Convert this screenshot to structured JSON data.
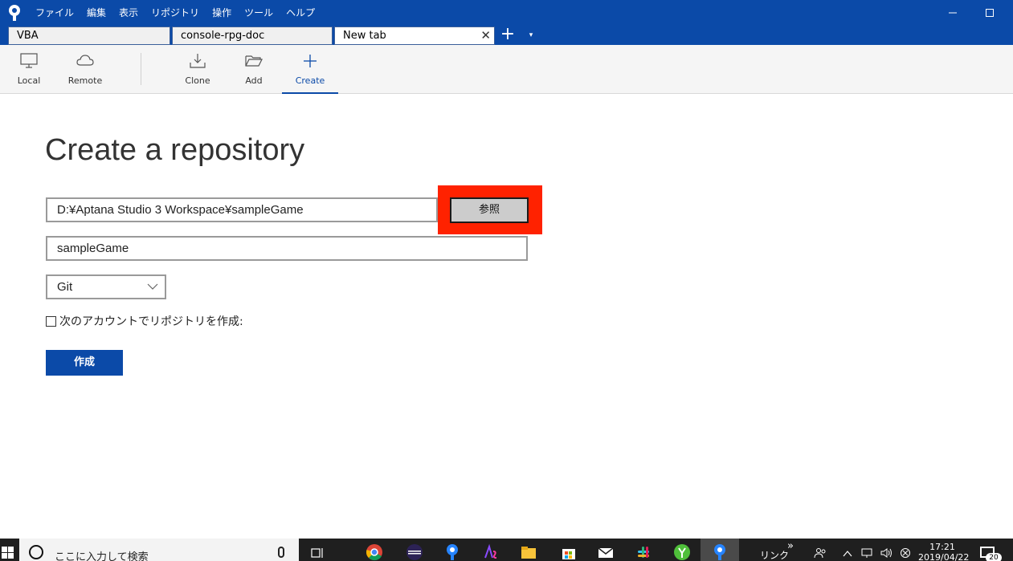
{
  "titlebar": {
    "menu": [
      "ファイル",
      "編集",
      "表示",
      "リポジトリ",
      "操作",
      "ツール",
      "ヘルプ"
    ]
  },
  "tabs": [
    {
      "label": "VBA"
    },
    {
      "label": "console-rpg-doc"
    },
    {
      "label": "New tab",
      "close": "✕"
    }
  ],
  "tab_controls": {
    "add": "+",
    "menu": "▾"
  },
  "toolbar": {
    "local": "Local",
    "remote": "Remote",
    "clone": "Clone",
    "add": "Add",
    "create": "Create"
  },
  "main": {
    "heading": "Create a repository",
    "path_value": "D:¥Aptana Studio 3 Workspace¥sampleGame",
    "browse_label": "参照",
    "name_value": "sampleGame",
    "vcs_selected": "Git",
    "account_checkbox_label": "次のアカウントでリポジトリを作成:",
    "account_checkbox_checked": false,
    "create_button": "作成"
  },
  "taskbar": {
    "search_placeholder": "ここに入力して検索",
    "links_label": "リンク",
    "links_chevron": "»",
    "clock_time": "17:21",
    "clock_date": "2019/04/22",
    "notification_count": "20"
  },
  "colors": {
    "brand": "#0b4aa8",
    "highlight": "#ff2200"
  }
}
